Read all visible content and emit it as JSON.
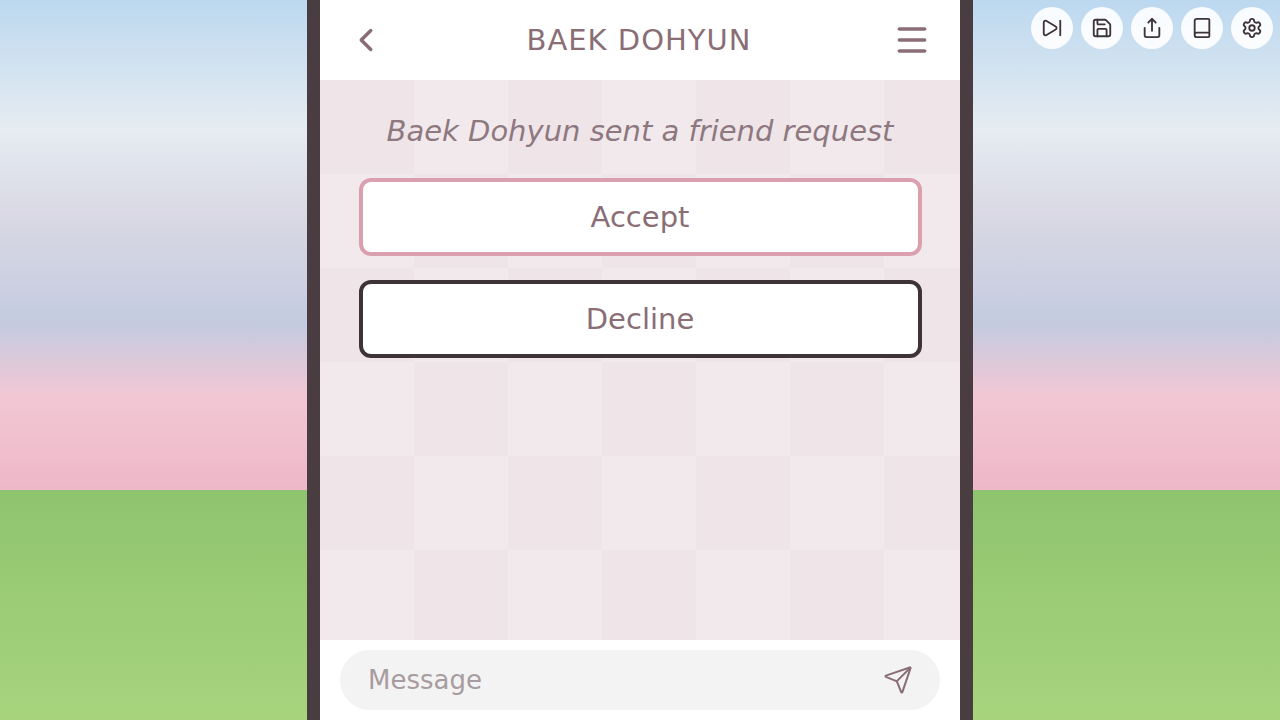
{
  "chat": {
    "title": "BAEK DOHYUN",
    "notice": "Baek Dohyun sent a friend request",
    "choices": [
      {
        "label": "Accept",
        "selected": true
      },
      {
        "label": "Decline",
        "selected": false
      }
    ],
    "input": {
      "placeholder": "Message"
    }
  }
}
